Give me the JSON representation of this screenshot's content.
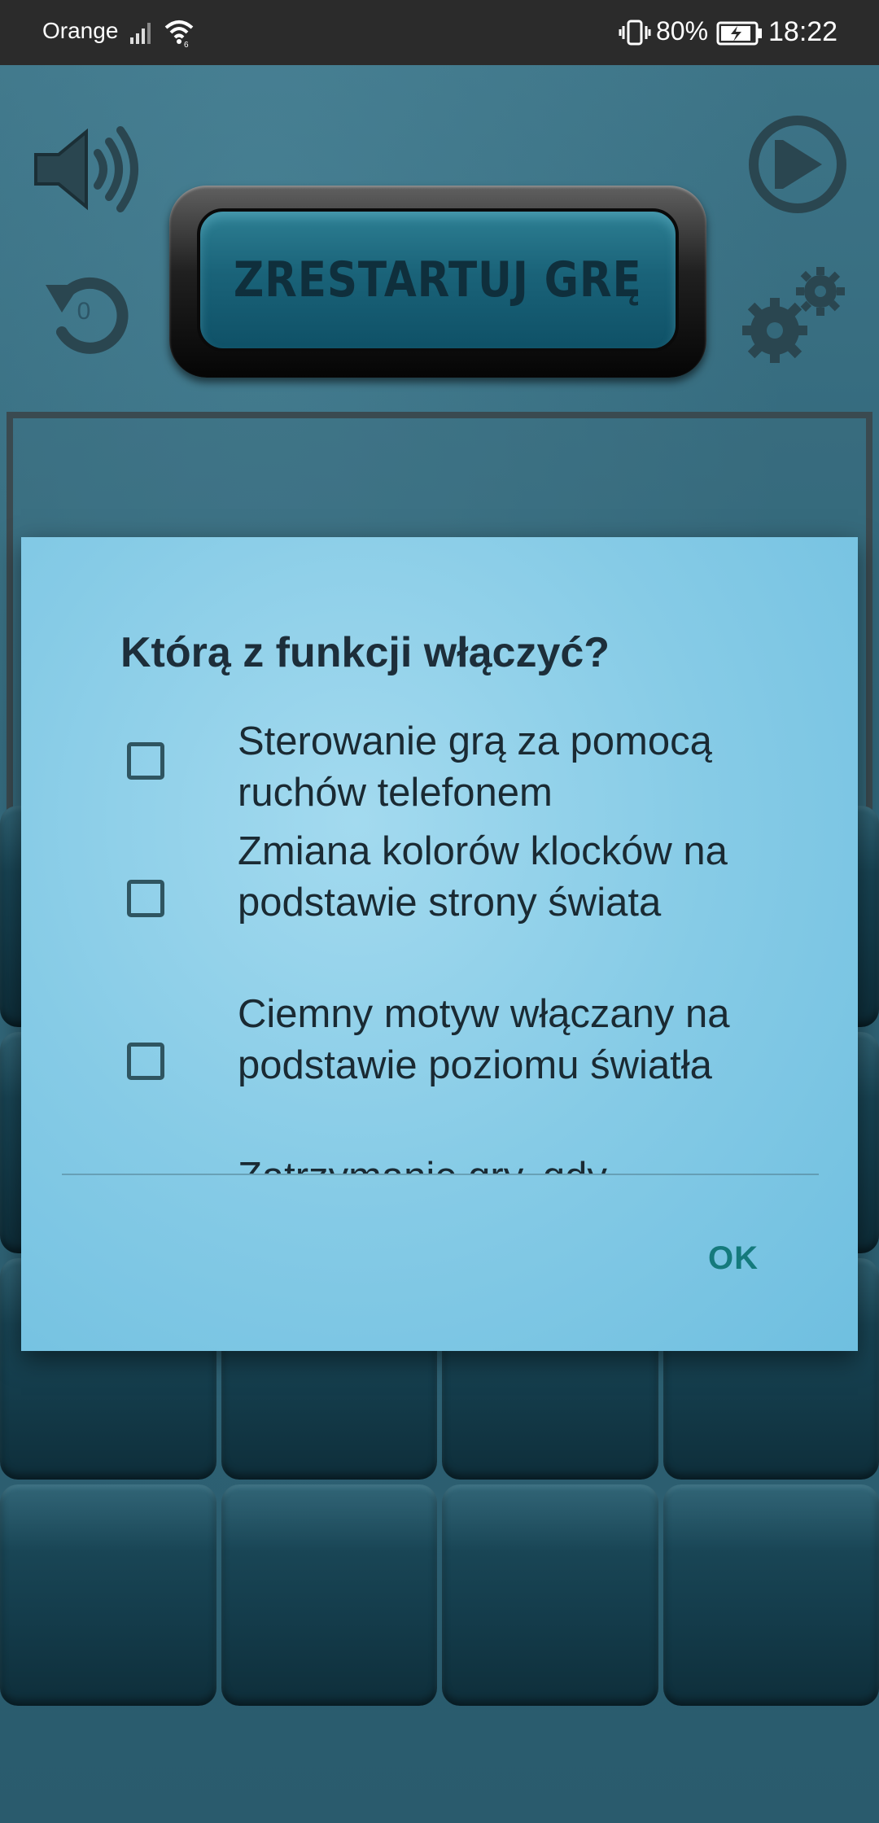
{
  "status_bar": {
    "carrier": "Orange",
    "battery_percent": "80%",
    "time": "18:22",
    "icons": [
      "signal-icon",
      "wifi-icon",
      "vibrate-icon",
      "battery-charging-icon"
    ]
  },
  "game": {
    "restart_label": "ZRESTARTUJ GRĘ",
    "undo_count": "0",
    "icons": [
      "sound-icon",
      "play-icon",
      "undo-icon",
      "settings-gear-icon"
    ]
  },
  "dialog": {
    "title": "Którą z funkcji włączyć?",
    "options": [
      {
        "label": "Sterowanie grą za pomocą ruchów telefonem",
        "checked": false
      },
      {
        "label": "Zmiana kolorów klocków na podstawie strony świata",
        "checked": false
      },
      {
        "label": "Ciemny motyw włączany na podstawie poziomu światła",
        "checked": false
      },
      {
        "label": "Zatrzymanie gry, gdy",
        "checked": false
      }
    ],
    "ok_label": "OK"
  },
  "colors": {
    "dialog_bg": "#86cbe6",
    "accent": "#157a7c",
    "tile": "#163f4e"
  }
}
